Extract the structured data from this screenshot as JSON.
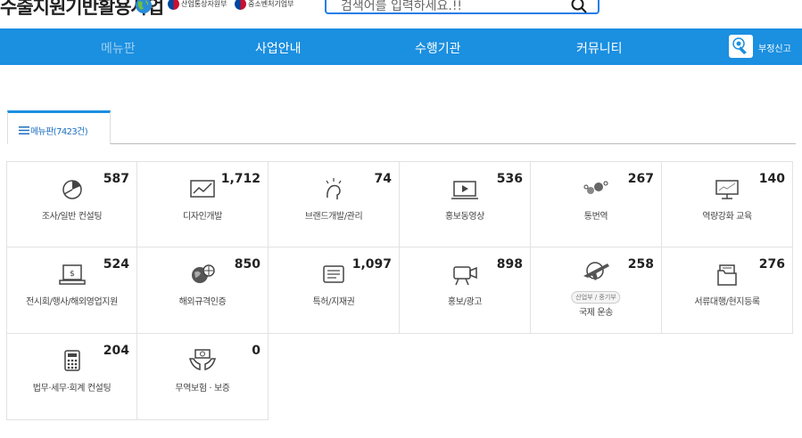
{
  "header": {
    "site_title": "수출지원기반활용사업",
    "gov_ministry_1": "산업통상자원부",
    "gov_ministry_2": "중소벤처기업부",
    "search_placeholder": "검색어를 입력하세요.!!"
  },
  "nav": {
    "items": [
      "메뉴판",
      "사업안내",
      "수행기관",
      "커뮤니티"
    ],
    "report_label": "부정신고"
  },
  "tab": {
    "label": "메뉴판(7423건)"
  },
  "cards": [
    {
      "count": "587",
      "label": "조사/일반 컨설팅",
      "icon": "chart-icon"
    },
    {
      "count": "1,712",
      "label": "디자인개발",
      "icon": "design-icon"
    },
    {
      "count": "74",
      "label": "브랜드개발/관리",
      "icon": "idea-icon"
    },
    {
      "count": "536",
      "label": "홍보동영상",
      "icon": "video-icon"
    },
    {
      "count": "267",
      "label": "통번역",
      "icon": "translation-icon"
    },
    {
      "count": "140",
      "label": "역량강화 교육",
      "icon": "education-icon"
    },
    {
      "count": "524",
      "label": "전시회/행사/해외영업지원",
      "icon": "exhibition-icon"
    },
    {
      "count": "850",
      "label": "해외규격인증",
      "icon": "certification-icon"
    },
    {
      "count": "1,097",
      "label": "특허/지재권",
      "icon": "patent-icon"
    },
    {
      "count": "898",
      "label": "홍보/광고",
      "icon": "advertising-icon"
    },
    {
      "count": "258",
      "label": "국제 운송",
      "badge": "산업부 / 중기부",
      "icon": "transport-icon"
    },
    {
      "count": "276",
      "label": "서류대행/현지등록",
      "icon": "document-icon"
    },
    {
      "count": "204",
      "label": "법무·세무·회계 컨설팅",
      "icon": "calculator-icon"
    },
    {
      "count": "0",
      "label": "무역보험 · 보증",
      "icon": "insurance-icon"
    }
  ],
  "colors": {
    "accent": "#1b8fe0",
    "search_border": "#1e7ee8"
  }
}
